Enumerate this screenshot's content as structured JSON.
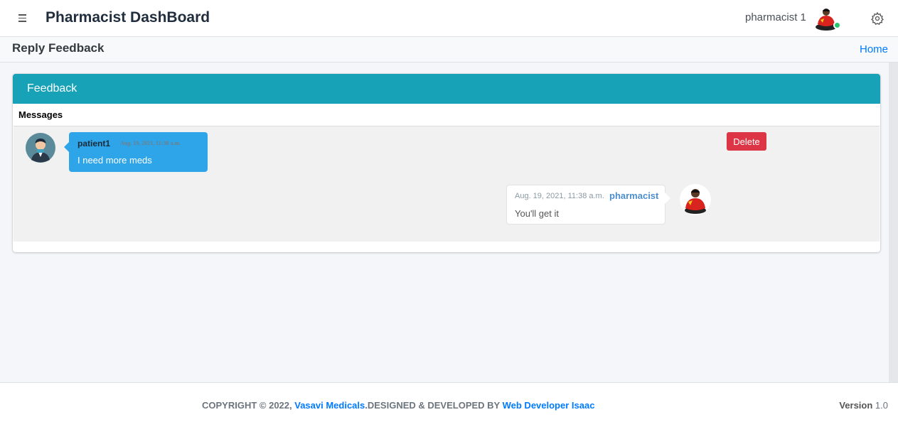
{
  "header": {
    "title": "Pharmacist DashBoard",
    "user_name": "pharmacist 1"
  },
  "subheader": {
    "page_title": "Reply Feedback",
    "home_link": "Home"
  },
  "card": {
    "title": "Feedback",
    "messages_label": "Messages"
  },
  "messages": [
    {
      "sender": "patient1",
      "time": "Aug. 19, 2021, 11:38 a.m.",
      "text": "I need more meds",
      "delete_label": "Delete"
    },
    {
      "sender": "pharmacist",
      "time": "Aug. 19, 2021, 11:38 a.m.",
      "text": "You'll get it"
    }
  ],
  "footer": {
    "copyright": "COPYRIGHT © 2022, ",
    "company": "Vasavi Medicals",
    "designed": ".DESIGNED & DEVELOPED BY ",
    "developer": "Web Developer Isaac",
    "version_label": "Version",
    "version_value": "1.0"
  },
  "colors": {
    "header_teal": "#17a2b8",
    "bubble_blue": "#2ea5e8",
    "delete_red": "#dc3545",
    "link_blue": "#007bff",
    "online_green": "#28c76f"
  }
}
